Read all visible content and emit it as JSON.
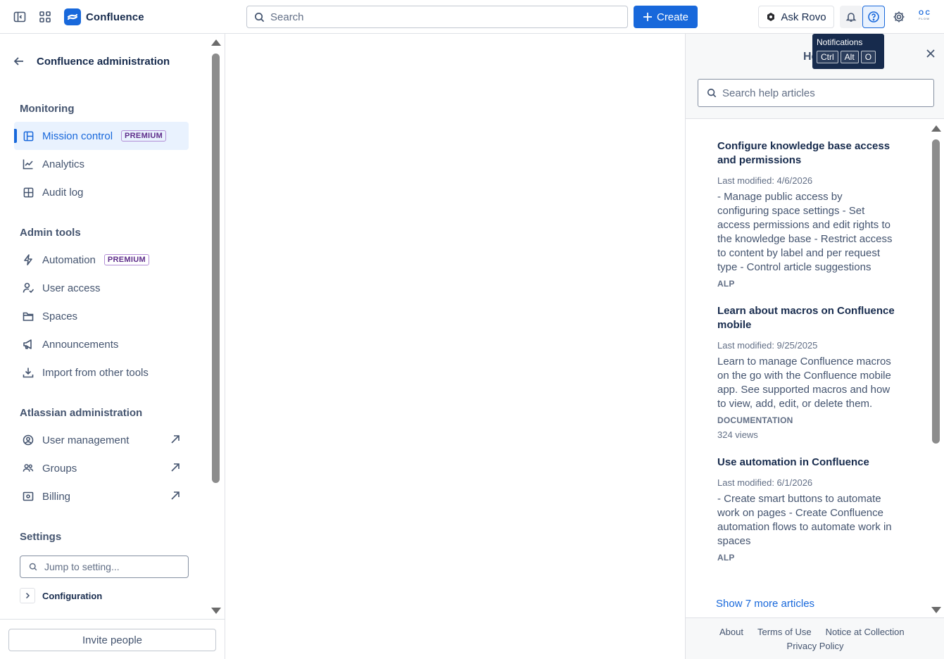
{
  "topbar": {
    "app_name": "Confluence",
    "search_placeholder": "Search",
    "create_label": "Create",
    "ask_rovo_label": "Ask Rovo",
    "avatar_initials": "O C",
    "avatar_sub": "FLOW"
  },
  "tooltip": {
    "label": "Notifications",
    "keys": [
      "Ctrl",
      "Alt",
      "O"
    ]
  },
  "sidebar": {
    "title": "Confluence administration",
    "sections": [
      {
        "heading": "Monitoring"
      },
      {
        "heading": "Admin tools"
      },
      {
        "heading": "Atlassian administration"
      },
      {
        "heading": "Settings"
      }
    ],
    "items": [
      {
        "label": "Mission control",
        "icon": "layout-icon",
        "badge": "PREMIUM",
        "active": true
      },
      {
        "label": "Analytics",
        "icon": "chart-line-icon"
      },
      {
        "label": "Audit log",
        "icon": "table-icon"
      },
      {
        "label": "Automation",
        "icon": "lightning-icon",
        "badge": "PREMIUM"
      },
      {
        "label": "User access",
        "icon": "person-check-icon"
      },
      {
        "label": "Spaces",
        "icon": "folder-icon"
      },
      {
        "label": "Announcements",
        "icon": "megaphone-icon"
      },
      {
        "label": "Import from other tools",
        "icon": "download-icon"
      },
      {
        "label": "User management",
        "icon": "person-circle-icon",
        "external": true
      },
      {
        "label": "Groups",
        "icon": "people-icon",
        "external": true
      },
      {
        "label": "Billing",
        "icon": "billing-icon",
        "external": true
      }
    ],
    "jump_placeholder": "Jump to setting...",
    "configuration_label": "Configuration",
    "invite_label": "Invite people"
  },
  "help": {
    "title": "Help",
    "search_placeholder": "Search help articles",
    "articles": [
      {
        "title": "Configure knowledge base access and permissions",
        "modified": "Last modified: 4/6/2026",
        "description": "- Manage public access by configuring space settings - Set access permissions and edit rights to the knowledge base - Restrict access to content by label and per request type - Control article suggestions",
        "tag": "ALP"
      },
      {
        "title": "Learn about macros on Confluence mobile",
        "modified": "Last modified: 9/25/2025",
        "description": "Learn to manage Confluence macros on the go with the Confluence mobile app. See supported macros and how to view, add, edit, or delete them.",
        "tag": "DOCUMENTATION",
        "views": "324 views"
      },
      {
        "title": "Use automation in Confluence",
        "modified": "Last modified: 6/1/2026",
        "description": "- Create smart buttons to automate work on pages - Create Confluence automation flows to automate work in spaces",
        "tag": "ALP"
      }
    ],
    "more_link": "Show 7 more articles",
    "footer": {
      "about": "About",
      "terms": "Terms of Use",
      "notice": "Notice at Collection",
      "privacy": "Privacy Policy"
    }
  },
  "colors": {
    "brand": "#1868db",
    "text": "#172b4d",
    "subtle": "#44546f"
  }
}
